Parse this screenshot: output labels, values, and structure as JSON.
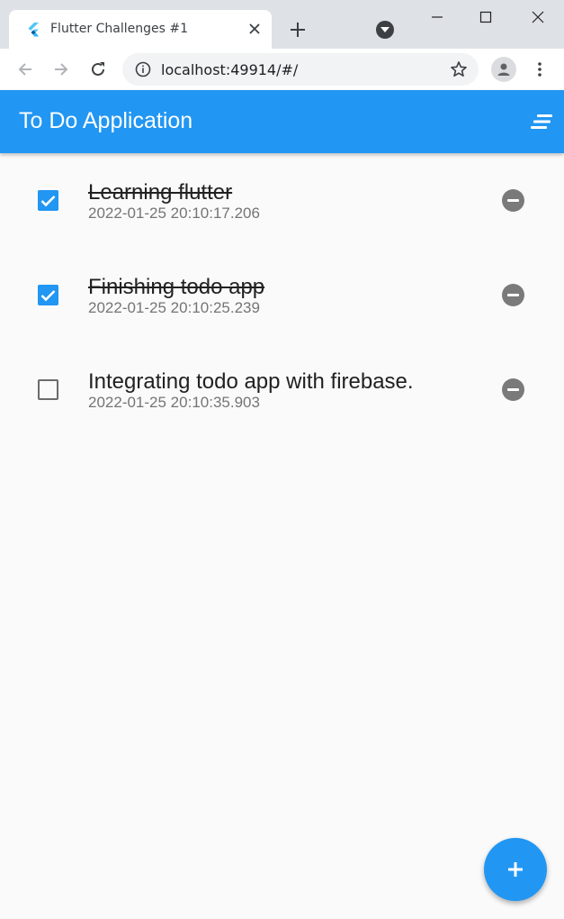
{
  "browser": {
    "tab_title": "Flutter Challenges #1",
    "url": "localhost:49914/#/"
  },
  "app": {
    "title": "To Do Application",
    "accent_color": "#2196f3"
  },
  "todos": [
    {
      "title": "Learning flutter",
      "date": "2022-01-25 20:10:17.206",
      "done": true
    },
    {
      "title": "Finishing todo app",
      "date": "2022-01-25 20:10:25.239",
      "done": true
    },
    {
      "title": "Integrating todo app with firebase.",
      "date": "2022-01-25 20:10:35.903",
      "done": false
    }
  ],
  "icons": {
    "tab_favicon": "flutter-logo-icon",
    "tab_close": "close-icon",
    "new_tab": "plus-icon",
    "tab_search": "chevron-down-icon",
    "back": "arrow-left-icon",
    "forward": "arrow-right-icon",
    "reload": "reload-icon",
    "site_info": "info-icon",
    "bookmark": "star-icon",
    "profile": "person-icon",
    "menu": "more-vert-icon",
    "sort": "sort-icon",
    "remove": "remove-circle-icon",
    "add": "plus-icon"
  }
}
